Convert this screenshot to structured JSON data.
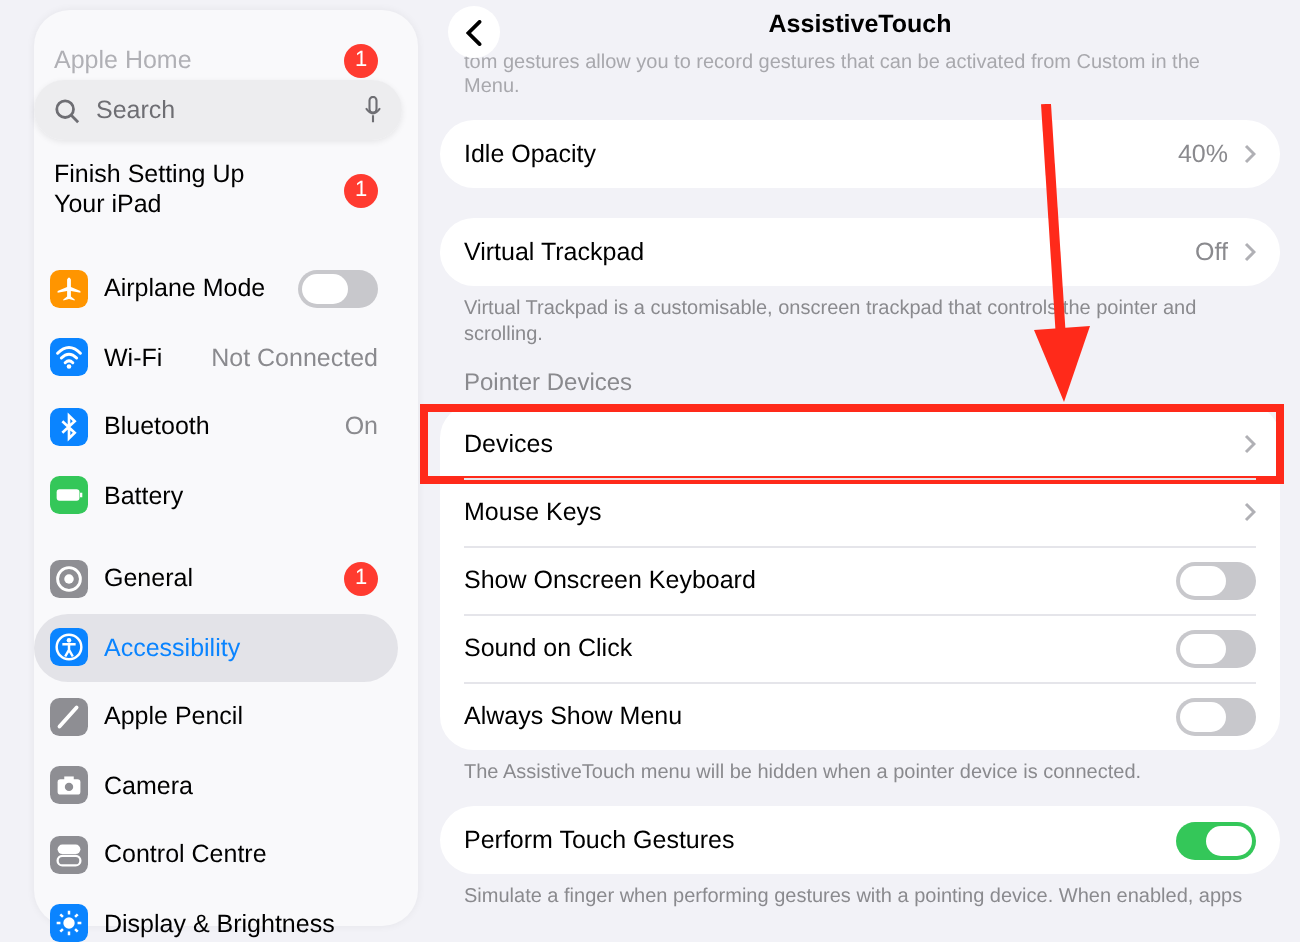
{
  "sidebar": {
    "faded_item": {
      "label": "Apple Home",
      "badge": "1"
    },
    "search": {
      "placeholder": "Search"
    },
    "notice": {
      "label": "Finish Setting Up Your iPad",
      "badge": "1"
    },
    "groups": [
      [
        {
          "label": "Airplane Mode",
          "kind": "toggle",
          "on": false,
          "color": "#ff9500",
          "selected": false
        },
        {
          "label": "Wi-Fi",
          "kind": "value",
          "value": "Not Connected",
          "color": "#0a84ff",
          "selected": false
        },
        {
          "label": "Bluetooth",
          "kind": "value",
          "value": "On",
          "color": "#0a84ff",
          "selected": false
        },
        {
          "label": "Battery",
          "kind": "plain",
          "color": "#34c759",
          "selected": false
        }
      ],
      [
        {
          "label": "General",
          "kind": "badge",
          "badge": "1",
          "color": "#8e8e93",
          "selected": false
        },
        {
          "label": "Accessibility",
          "kind": "plain",
          "color": "#0a84ff",
          "selected": true
        },
        {
          "label": "Apple Pencil",
          "kind": "plain",
          "color": "#8e8e93",
          "selected": false
        },
        {
          "label": "Camera",
          "kind": "plain",
          "color": "#8e8e93",
          "selected": false
        },
        {
          "label": "Control Centre",
          "kind": "plain",
          "color": "#8e8e93",
          "selected": false
        },
        {
          "label": "Display & Brightness",
          "kind": "plain",
          "color": "#0a84ff",
          "selected": false
        }
      ]
    ]
  },
  "detail": {
    "title": "AssistiveTouch",
    "top_caption": "tom gestures allow you to record gestures that can be activated from Custom in the Menu.",
    "sections": [
      {
        "rows": [
          {
            "label": "Idle Opacity",
            "kind": "link",
            "value": "40%"
          }
        ]
      },
      {
        "rows": [
          {
            "label": "Virtual Trackpad",
            "kind": "link",
            "value": "Off"
          }
        ],
        "footer": "Virtual Trackpad is a customisable, onscreen trackpad that controls the pointer and scrolling."
      },
      {
        "header": "Pointer Devices",
        "rows": [
          {
            "label": "Devices",
            "kind": "link",
            "highlighted": true
          },
          {
            "label": "Mouse Keys",
            "kind": "link",
            "highlighted": false
          },
          {
            "label": "Show Onscreen Keyboard",
            "kind": "toggle",
            "on": false
          },
          {
            "label": "Sound on Click",
            "kind": "toggle",
            "on": false
          },
          {
            "label": "Always Show Menu",
            "kind": "toggle",
            "on": false
          }
        ],
        "footer": "The AssistiveTouch menu will be hidden when a pointer device is connected."
      },
      {
        "rows": [
          {
            "label": "Perform Touch Gestures",
            "kind": "toggle",
            "on": true
          }
        ],
        "footer": "Simulate a finger when performing gestures with a pointing device. When enabled, apps"
      }
    ]
  }
}
